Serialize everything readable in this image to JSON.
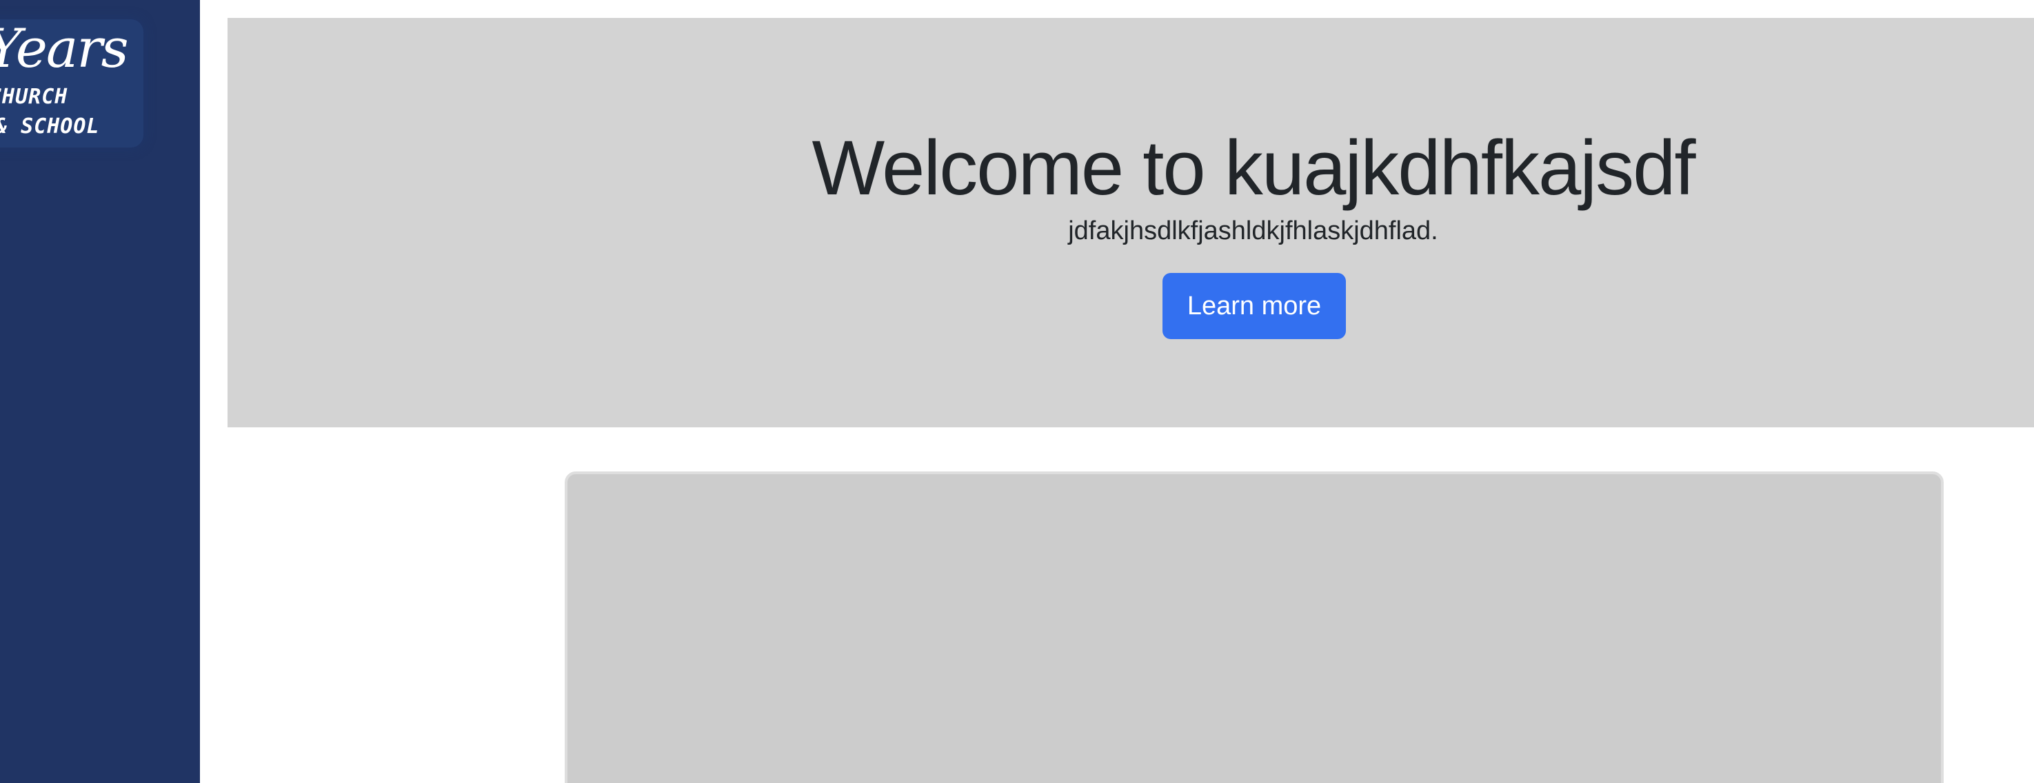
{
  "sidebar": {
    "logo": {
      "script_text": "Years",
      "line1": "CHURCH",
      "line2": "& SCHOOL"
    },
    "background_color": "#203464"
  },
  "hero": {
    "title": "Welcome to kuajkdhfkajsdf",
    "lead": "jdfakjhsdlkfjashldkjfhlaskjdhflad.",
    "button_label": "Learn more",
    "background_color": "#d3d3d3",
    "button_color": "#3370f0"
  },
  "card": {
    "background_color": "#cccccc"
  }
}
